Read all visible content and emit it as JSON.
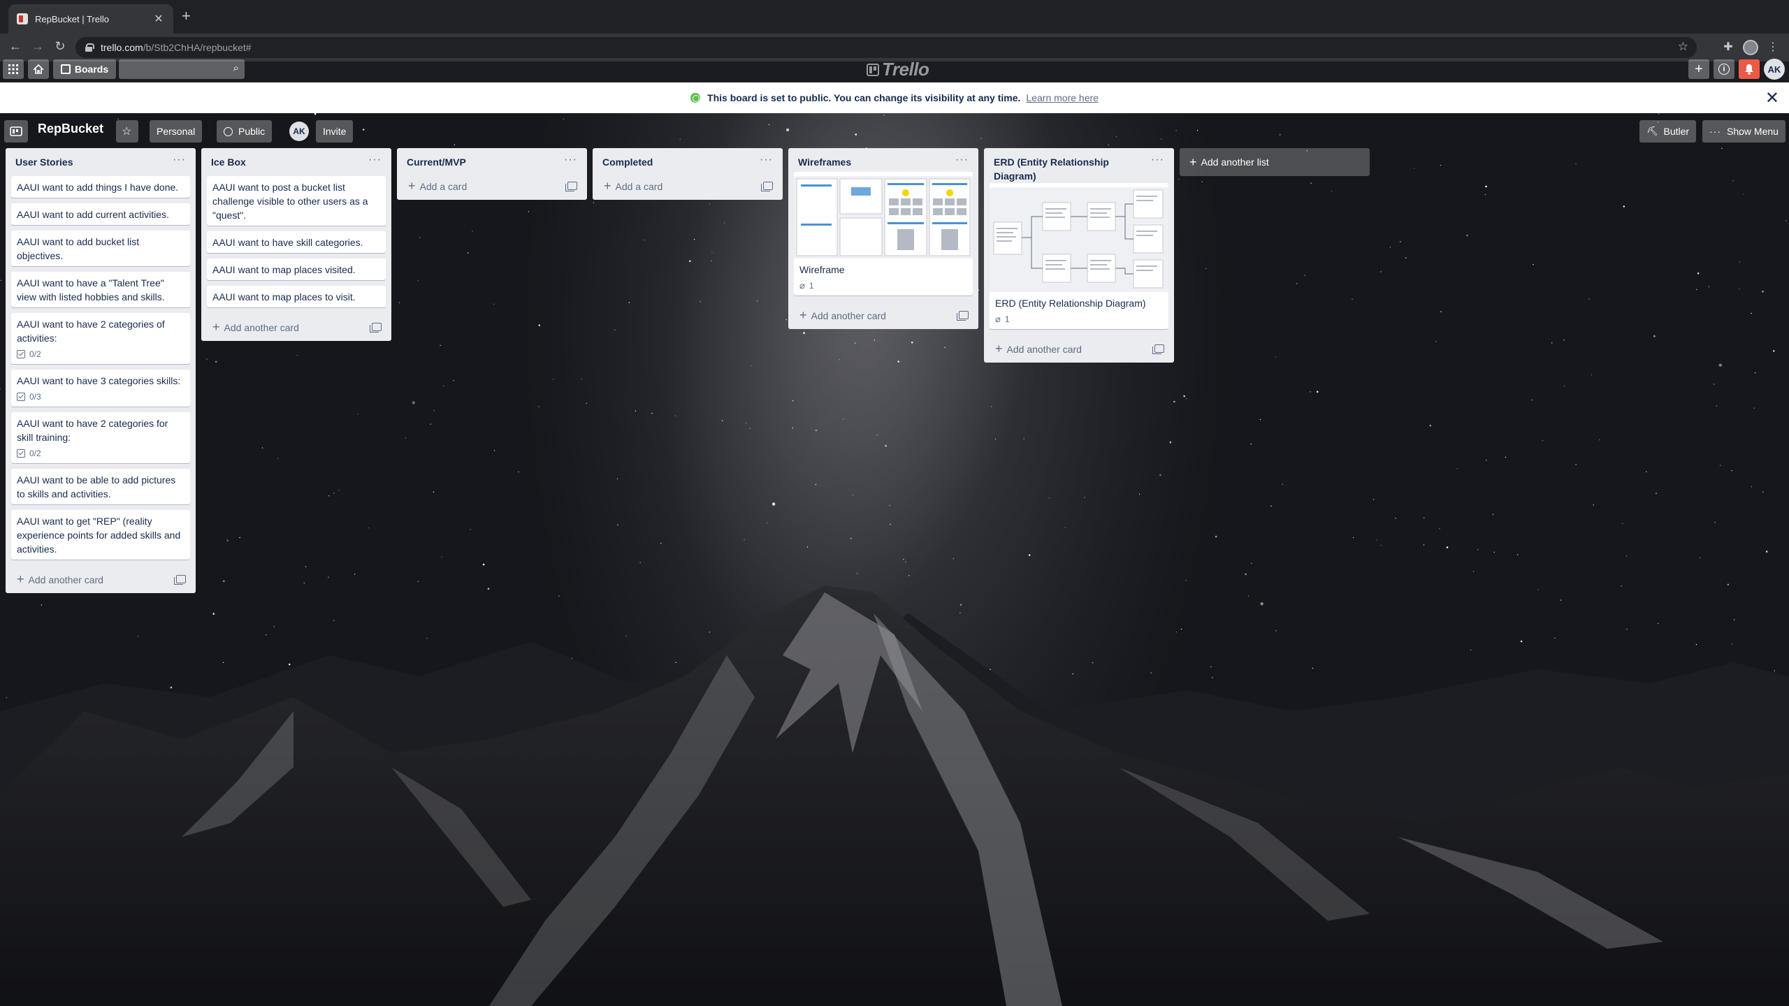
{
  "browser": {
    "tab_title": "RepBucket | Trello",
    "url_host": "trello.com",
    "url_path": "/b/Stb2ChHA/repbucket#"
  },
  "header": {
    "boards_label": "Boards",
    "logo_text": "Trello",
    "user_initials": "AK"
  },
  "banner": {
    "message": "This board is set to public. You can change its visibility at any time.",
    "link": "Learn more here"
  },
  "board": {
    "title": "RepBucket",
    "team_label": "Personal",
    "visibility_label": "Public",
    "member_initials": "AK",
    "invite_label": "Invite",
    "butler_label": "Butler",
    "menu_label": "Show Menu"
  },
  "lists": [
    {
      "title": "User Stories",
      "cards": [
        {
          "text": "AAUI want to add things I have done."
        },
        {
          "text": "AAUI want to add current activities."
        },
        {
          "text": "AAUI want to add bucket list objectives."
        },
        {
          "text": "AAUI want to have a \"Talent Tree\" view with listed hobbies and skills."
        },
        {
          "text": "AAUI want to have 2 categories of activities:",
          "checklist": "0/2"
        },
        {
          "text": "AAUI want to have 3 categories skills:",
          "checklist": "0/3"
        },
        {
          "text": "AAUI want to have 2 categories for skill training:",
          "checklist": "0/2"
        },
        {
          "text": "AAUI want to be able to add pictures to skills and activities."
        },
        {
          "text": "AAUI want to get \"REP\" (reality experience points for added skills and activities."
        }
      ],
      "footer": "Add another card"
    },
    {
      "title": "Ice Box",
      "cards": [
        {
          "text": "AAUI want to post a bucket list challenge visible to other users as a \"quest\"."
        },
        {
          "text": "AAUI want to have skill categories."
        },
        {
          "text": "AAUI want to map places visited."
        },
        {
          "text": "AAUI want to map places to visit."
        }
      ],
      "footer": "Add another card"
    },
    {
      "title": "Current/MVP",
      "cards": [],
      "footer": "Add a card"
    },
    {
      "title": "Completed",
      "cards": [],
      "footer": "Add a card"
    },
    {
      "title": "Wireframes",
      "cards": [
        {
          "text": "Wireframe",
          "attachments": "1"
        }
      ],
      "footer": "Add another card"
    },
    {
      "title": "ERD (Entity Relationship Diagram)",
      "cards": [
        {
          "text": "ERD (Entity Relationship Diagram)",
          "attachments": "1"
        }
      ],
      "footer": "Add another card"
    }
  ],
  "add_list_label": "Add another list"
}
